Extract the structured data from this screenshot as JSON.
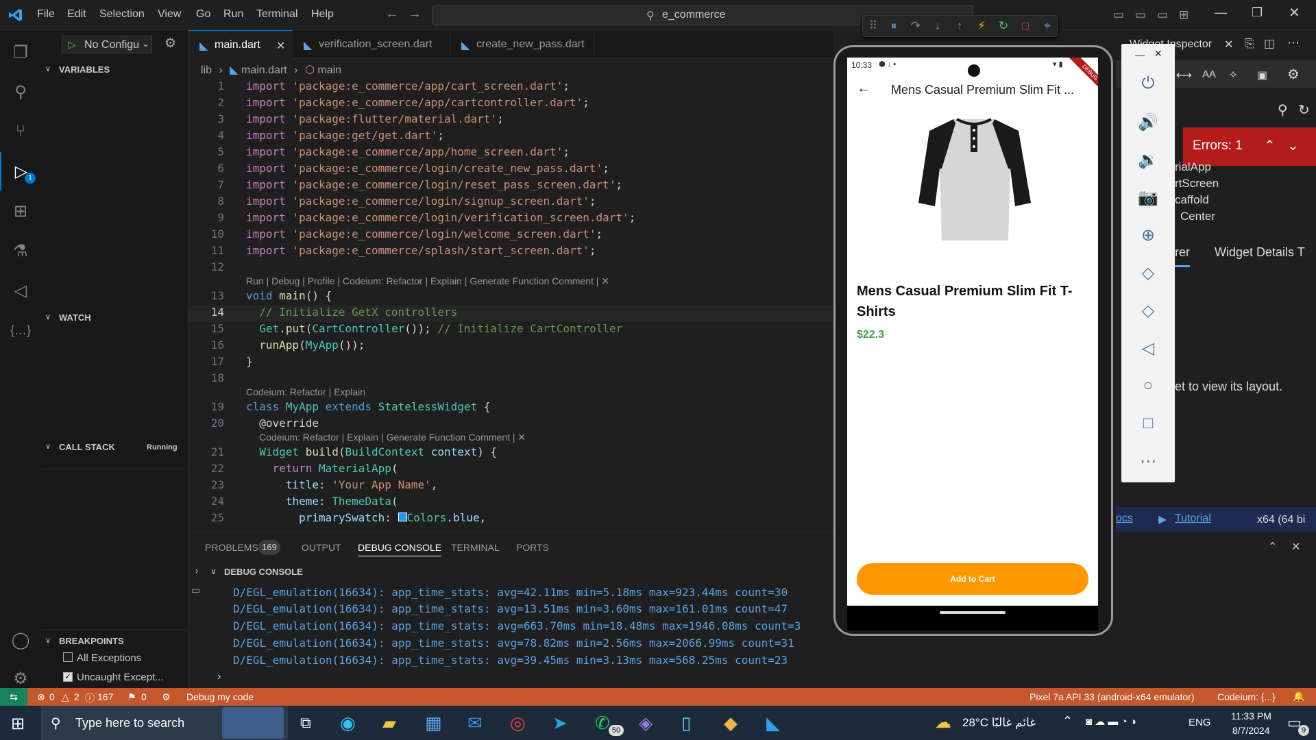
{
  "titlebar": {
    "menu": [
      "File",
      "Edit",
      "Selection",
      "View",
      "Go",
      "Run",
      "Terminal",
      "Help"
    ],
    "search_text": "e_commerce"
  },
  "sidebar": {
    "run_config": "No Configu",
    "variables_title": "VARIABLES",
    "watch_title": "WATCH",
    "callstack_title": "CALL STACK",
    "callstack_status": "Running",
    "breakpoints_title": "BREAKPOINTS",
    "breakpoints": [
      "All Exceptions",
      "Uncaught Except..."
    ],
    "debug_badge": "1"
  },
  "tabs": [
    "main.dart",
    "verification_screen.dart",
    "create_new_pass.dart"
  ],
  "breadcrumb": {
    "folder": "lib",
    "file": "main.dart",
    "symbol": "main"
  },
  "code": {
    "lens1": "Run | Debug | Profile | Codeium: Refactor | Explain | Generate Function Comment | ✕",
    "lens2": "Codeium: Refactor | Explain",
    "lens3": "Codeium: Refactor | Explain | Generate Function Comment | ✕"
  },
  "panel": {
    "tabs": [
      "PROBLEMS",
      "OUTPUT",
      "DEBUG CONSOLE",
      "TERMINAL",
      "PORTS"
    ],
    "problems_count": "169",
    "console_title": "DEBUG CONSOLE",
    "logs": [
      "D/EGL_emulation(16634): app_time_stats: avg=42.11ms min=5.18ms max=923.44ms count=30",
      "D/EGL_emulation(16634): app_time_stats: avg=13.51ms min=3.60ms max=161.01ms count=47",
      "D/EGL_emulation(16634): app_time_stats: avg=663.70ms min=18.48ms max=1946.08ms count=3",
      "D/EGL_emulation(16634): app_time_stats: avg=78.82ms min=2.56ms max=2066.99ms count=31",
      "D/EGL_emulation(16634): app_time_stats: avg=39.45ms min=3.13ms max=568.25ms count=23"
    ]
  },
  "statusbar": {
    "errors": "0",
    "warnings": "2",
    "info": "167",
    "ports": "0",
    "debug_label": "Debug my code",
    "device": "Pixel 7a API 33 (android-x64 emulator)",
    "codeium": "Codeium: {...}"
  },
  "phone": {
    "time": "10:33",
    "appbar_title": "Mens Casual Premium Slim Fit ...",
    "product_title": "Mens Casual Premium Slim Fit T-Shirts",
    "price": "$22.3",
    "button": "Add to Cart",
    "debug_ribbon": "DEBUG"
  },
  "inspector": {
    "title": "Widget Inspector",
    "errors": "Errors: 1",
    "tree": [
      "rialApp",
      "rtScreen",
      "caffold",
      "Center"
    ],
    "tab_left": "rer",
    "tab_right": "Widget Details T",
    "hint": "et to view its layout.",
    "footer_docs": "ocs",
    "footer_tutorial": "Tutorial",
    "footer_arch": "x64 (64 bi"
  },
  "taskbar": {
    "search_placeholder": "Type here to search",
    "weather": "28°C  غائم غالبًا",
    "lang": "ENG",
    "time": "11:33 PM",
    "date": "8/7/2024",
    "whatsapp_badge": "50",
    "notif_badge": "9"
  }
}
